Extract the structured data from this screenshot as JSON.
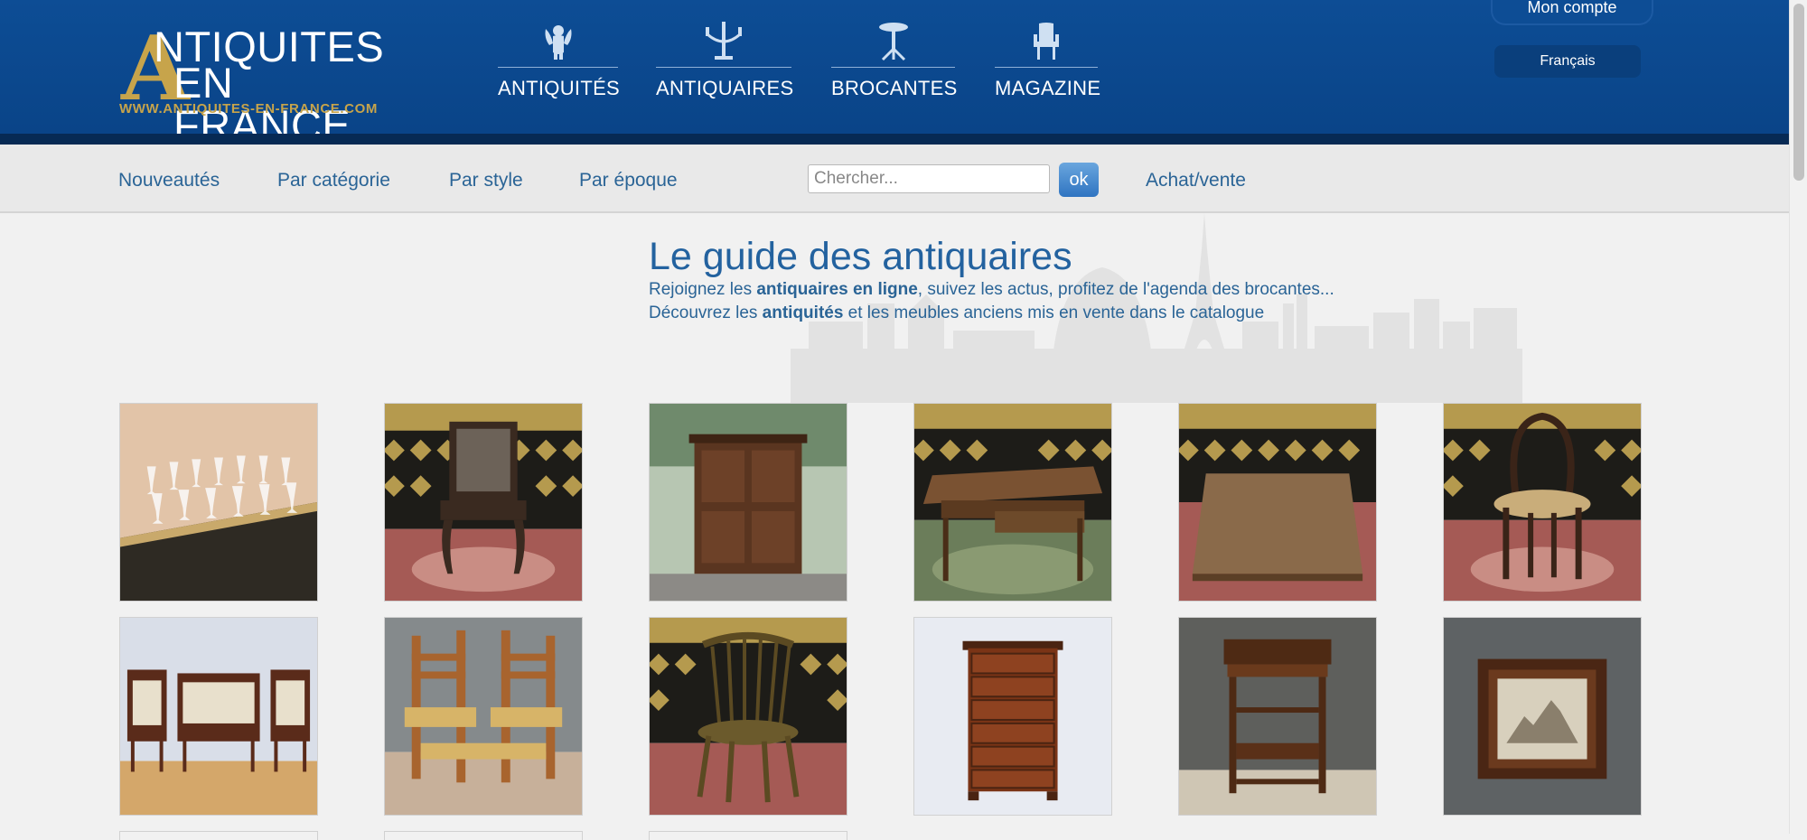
{
  "header": {
    "logo": {
      "big_letter": "A",
      "line1": "NTIQUITES",
      "line2": "EN FRANCE",
      "url": "WWW.ANTIQUITES-EN-FRANCE.COM"
    },
    "nav": [
      {
        "label": "ANTIQUITÉS",
        "icon": "cherub-icon"
      },
      {
        "label": "ANTIQUAIRES",
        "icon": "candelabra-icon"
      },
      {
        "label": "BROCANTES",
        "icon": "pedestal-table-icon"
      },
      {
        "label": "MAGAZINE",
        "icon": "armchair-icon"
      }
    ],
    "account_label": "Mon compte",
    "language_label": "Français"
  },
  "subnav": {
    "links": [
      "Nouveautés",
      "Par catégorie",
      "Par style",
      "Par époque"
    ],
    "search_placeholder": "Chercher...",
    "search_button": "ok",
    "buy_sell": "Achat/vente"
  },
  "main": {
    "title": "Le guide des antiquaires",
    "intro1": {
      "a": "Rejoignez les ",
      "b": "antiquaires en ligne",
      "c": ", suivez les actus, profitez de l'agenda des brocantes..."
    },
    "intro2": {
      "a": "Découvrez les ",
      "b": "antiquités",
      "c": " et les meubles anciens mis en vente dans le catalogue"
    }
  },
  "products": [
    {
      "icon": "crystal-glasses-photo"
    },
    {
      "icon": "carved-chair-photo"
    },
    {
      "icon": "wooden-cupboard-photo"
    },
    {
      "icon": "drawer-table-photo"
    },
    {
      "icon": "square-table-photo"
    },
    {
      "icon": "bistro-chair-photo"
    },
    {
      "icon": "sofa-set-photo"
    },
    {
      "icon": "rush-chairs-photo"
    },
    {
      "icon": "windsor-chair-photo"
    },
    {
      "icon": "chest-of-drawers-photo"
    },
    {
      "icon": "sewing-table-photo"
    },
    {
      "icon": "framed-engraving-photo"
    }
  ],
  "colors": {
    "header_blue": "#0d4d95",
    "header_dark": "#072a54",
    "gold": "#c7a44b",
    "link_blue": "#2a6496"
  }
}
